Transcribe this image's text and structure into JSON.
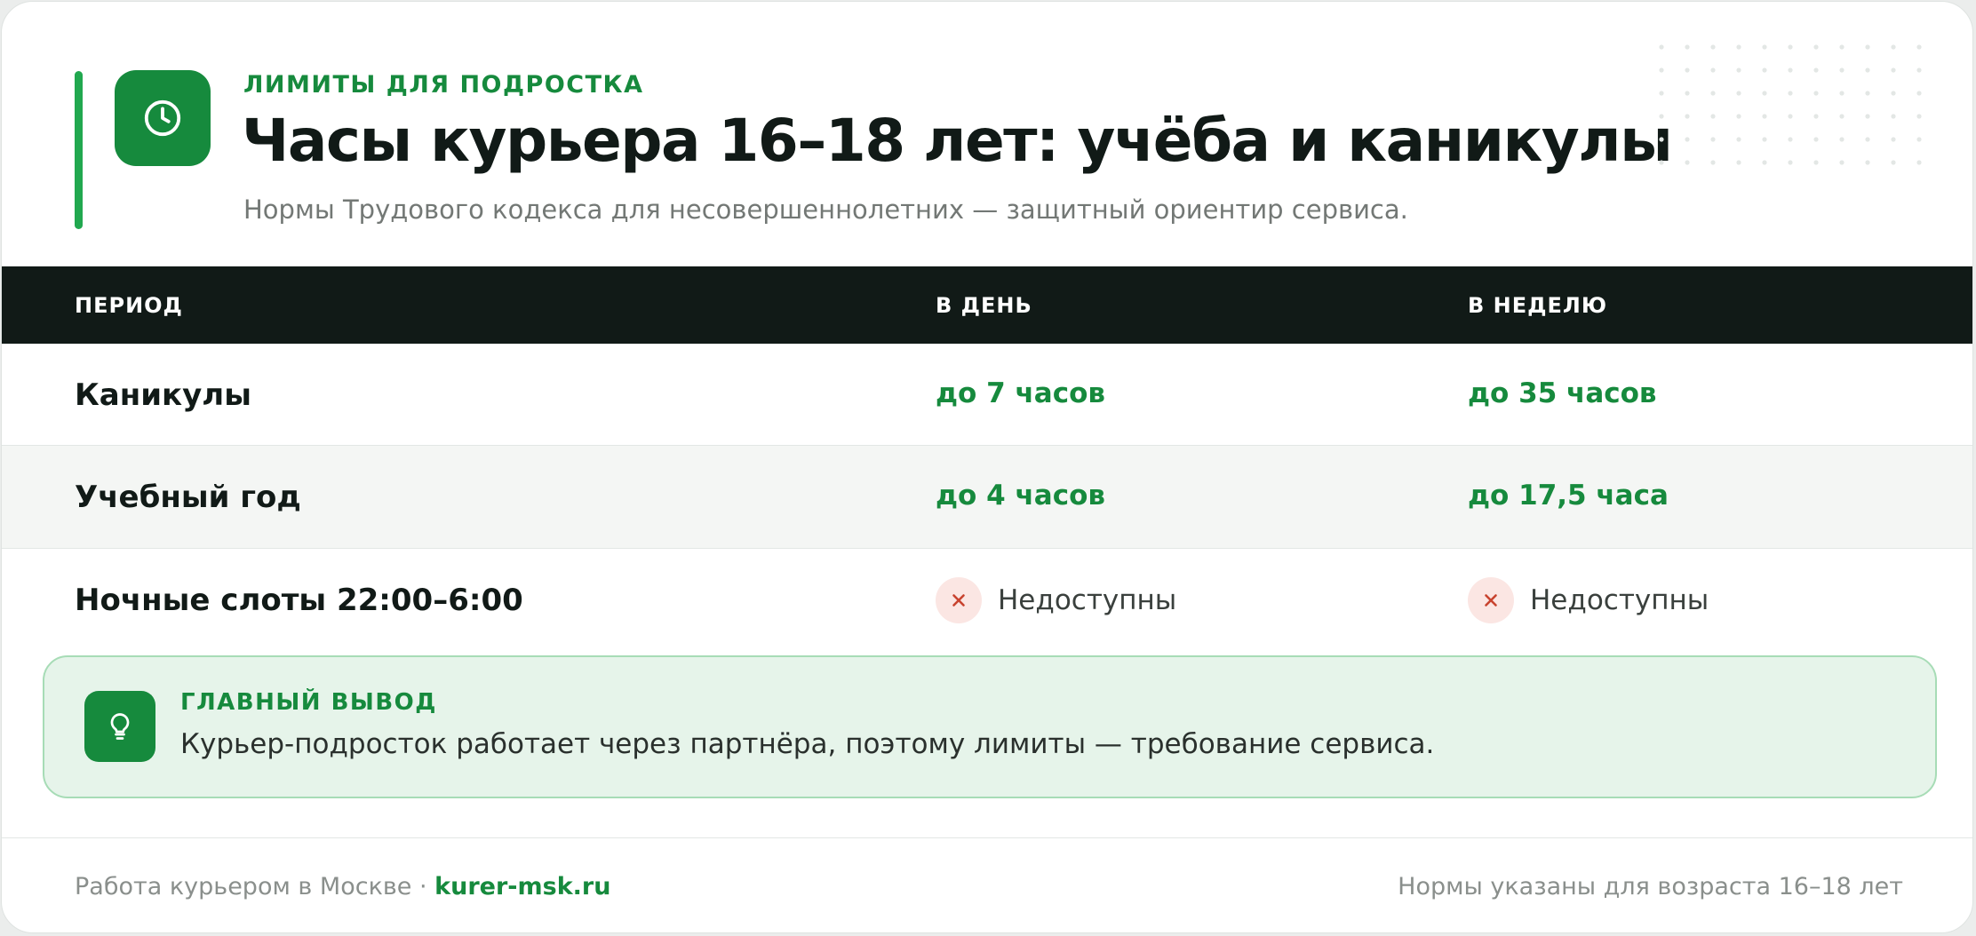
{
  "header": {
    "eyebrow": "ЛИМИТЫ ДЛЯ ПОДРОСТКА",
    "title": "Часы курьера 16–18 лет: учёба и каникулы",
    "subtitle": "Нормы Трудового кодекса для несовершеннолетних — защитный ориентир сервиса.",
    "icon": "clock-icon"
  },
  "table": {
    "headers": {
      "period": "ПЕРИОД",
      "day": "В ДЕНЬ",
      "week": "В НЕДЕЛЮ"
    },
    "rows": [
      {
        "period": "Каникулы",
        "day": "до 7 часов",
        "week": "до 35 часов"
      },
      {
        "period": "Учебный год",
        "day": "до 4 часов",
        "week": "до 17,5 часа"
      },
      {
        "period": "Ночные слоты 22:00–6:00",
        "day": "Недоступны",
        "week": "Недоступны",
        "status_icon": "x-icon"
      }
    ]
  },
  "takeaway": {
    "title": "ГЛАВНЫЙ ВЫВОД",
    "text": "Курьер-подросток работает через партнёра, поэтому лимиты — требование сервиса.",
    "icon": "lightbulb-icon"
  },
  "footer": {
    "left_text": "Работа курьером в Москве · ",
    "link": "kurer-msk.ru",
    "right_text": "Нормы указаны для возраста 16–18 лет"
  },
  "colors": {
    "accent": "#168a3d",
    "accent_bright": "#21a84f",
    "header_bg": "#111a17",
    "danger": "#c8432f",
    "takeaway_bg": "#e6f4ea"
  }
}
